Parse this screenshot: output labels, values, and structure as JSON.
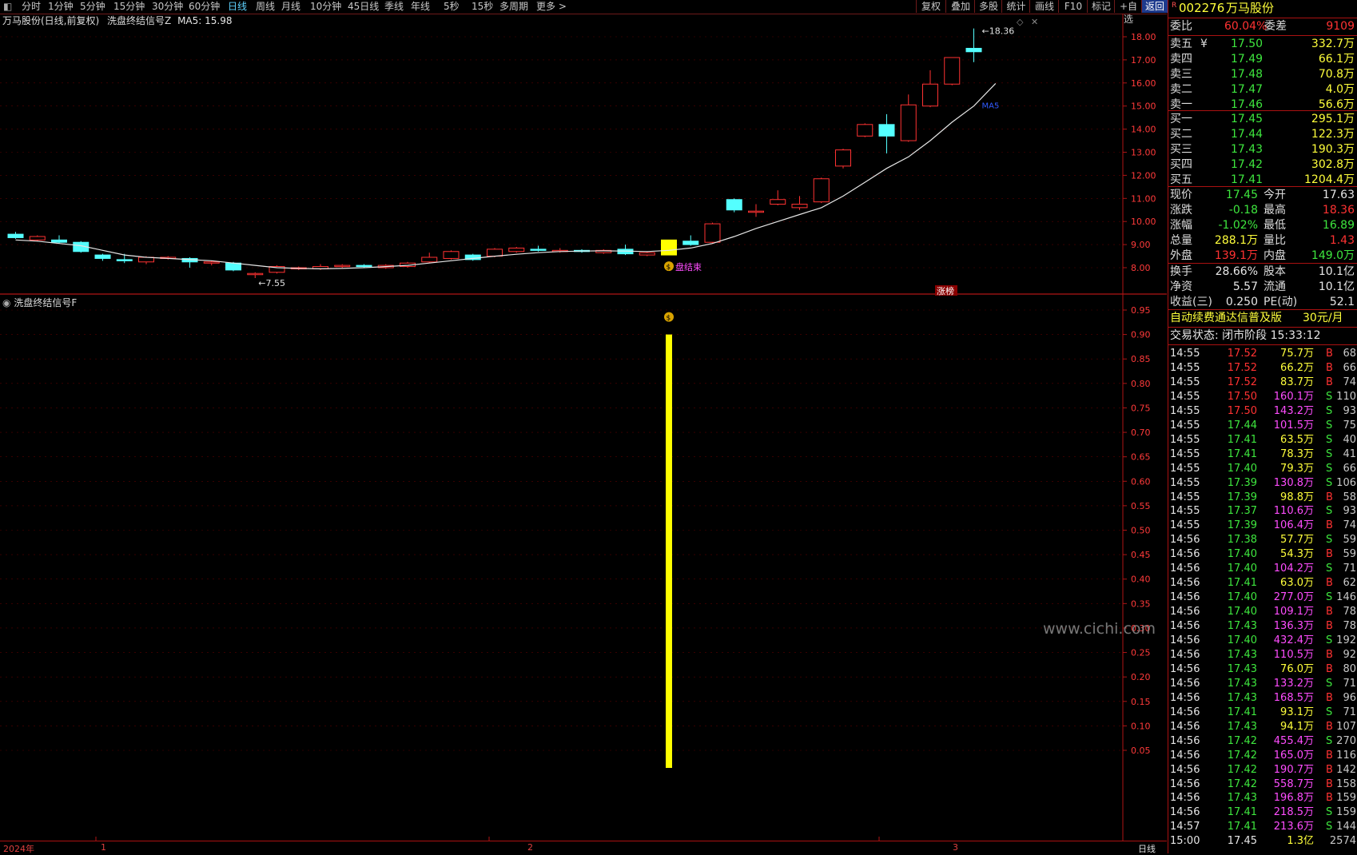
{
  "toolbar": {
    "timeframes": [
      "分时",
      "1分钟",
      "5分钟",
      "15分钟",
      "30分钟",
      "60分钟",
      "日线",
      "周线",
      "月线",
      "10分钟",
      "45日线",
      "季线",
      "年线",
      "5秒",
      "15秒",
      "多周期",
      "更多 >"
    ],
    "active": "日线",
    "buttons": [
      "复权",
      "叠加",
      "多股",
      "统计",
      "画线",
      "F10",
      "标记",
      "+自选",
      "返回"
    ]
  },
  "main_chart": {
    "title": "万马股份(日线,前复权)",
    "indicator": "洗盘终结信号Z",
    "ma_label": "MA5: 15.98",
    "high_label": "18.36",
    "low_label": "7.55",
    "signal_label": "盘结束",
    "ma_tag": "MA5",
    "badge": "涨榜",
    "y_ticks": [
      "18.00",
      "17.00",
      "16.00",
      "15.00",
      "14.00",
      "13.00",
      "12.00",
      "11.00",
      "10.00",
      "9.00",
      "8.00"
    ]
  },
  "sub_chart": {
    "title": "洗盘终结信号F",
    "y_ticks": [
      "0.95",
      "0.90",
      "0.85",
      "0.80",
      "0.75",
      "0.70",
      "0.65",
      "0.60",
      "0.55",
      "0.50",
      "0.45",
      "0.40",
      "0.35",
      "0.30",
      "0.25",
      "0.20",
      "0.15",
      "0.10",
      "0.05"
    ]
  },
  "chart_data": {
    "type": "candlestick",
    "title": "万马股份(日线,前复权)",
    "ma5_last": 15.98,
    "ylim": [
      7.4,
      18.5
    ],
    "x_axis_labels": [
      "2024年",
      "1",
      "2",
      "3"
    ],
    "candles": [
      {
        "o": 9.45,
        "c": 9.3,
        "h": 9.55,
        "l": 9.25
      },
      {
        "o": 9.2,
        "c": 9.35,
        "h": 9.4,
        "l": 9.15
      },
      {
        "o": 9.2,
        "c": 9.1,
        "h": 9.4,
        "l": 9.05
      },
      {
        "o": 9.1,
        "c": 8.7,
        "h": 9.15,
        "l": 8.65
      },
      {
        "o": 8.55,
        "c": 8.4,
        "h": 8.6,
        "l": 8.3
      },
      {
        "o": 8.35,
        "c": 8.3,
        "h": 8.6,
        "l": 8.2
      },
      {
        "o": 8.25,
        "c": 8.45,
        "h": 8.5,
        "l": 8.15
      },
      {
        "o": 8.4,
        "c": 8.45,
        "h": 8.5,
        "l": 8.35
      },
      {
        "o": 8.4,
        "c": 8.25,
        "h": 8.45,
        "l": 8.0
      },
      {
        "o": 8.25,
        "c": 8.25,
        "h": 8.3,
        "l": 8.1
      },
      {
        "o": 8.2,
        "c": 7.9,
        "h": 8.25,
        "l": 7.85
      },
      {
        "o": 7.75,
        "c": 7.75,
        "h": 7.8,
        "l": 7.55
      },
      {
        "o": 7.8,
        "c": 8.05,
        "h": 8.1,
        "l": 7.75
      },
      {
        "o": 7.95,
        "c": 8.0,
        "h": 8.05,
        "l": 7.9
      },
      {
        "o": 7.95,
        "c": 8.05,
        "h": 8.15,
        "l": 7.9
      },
      {
        "o": 8.05,
        "c": 8.1,
        "h": 8.15,
        "l": 8.0
      },
      {
        "o": 8.1,
        "c": 8.05,
        "h": 8.15,
        "l": 8.0
      },
      {
        "o": 8.0,
        "c": 8.1,
        "h": 8.15,
        "l": 7.95
      },
      {
        "o": 8.05,
        "c": 8.2,
        "h": 8.25,
        "l": 8.0
      },
      {
        "o": 8.25,
        "c": 8.45,
        "h": 8.65,
        "l": 8.2
      },
      {
        "o": 8.4,
        "c": 8.7,
        "h": 8.75,
        "l": 8.35
      },
      {
        "o": 8.55,
        "c": 8.35,
        "h": 8.6,
        "l": 8.3
      },
      {
        "o": 8.5,
        "c": 8.8,
        "h": 8.85,
        "l": 8.45
      },
      {
        "o": 8.7,
        "c": 8.85,
        "h": 8.9,
        "l": 8.65
      },
      {
        "o": 8.8,
        "c": 8.75,
        "h": 8.95,
        "l": 8.7
      },
      {
        "o": 8.75,
        "c": 8.75,
        "h": 8.85,
        "l": 8.65
      },
      {
        "o": 8.75,
        "c": 8.7,
        "h": 8.8,
        "l": 8.65
      },
      {
        "o": 8.65,
        "c": 8.75,
        "h": 8.8,
        "l": 8.6
      },
      {
        "o": 8.8,
        "c": 8.6,
        "h": 9.0,
        "l": 8.55
      },
      {
        "o": 8.55,
        "c": 8.65,
        "h": 8.7,
        "l": 8.5
      },
      {
        "o": 8.55,
        "c": 9.2,
        "h": 9.2,
        "l": 8.55,
        "signal": true
      },
      {
        "o": 9.15,
        "c": 9.0,
        "h": 9.4,
        "l": 8.95
      },
      {
        "o": 9.1,
        "c": 9.9,
        "h": 9.95,
        "l": 9.05
      },
      {
        "o": 10.95,
        "c": 10.5,
        "h": 11.0,
        "l": 10.4
      },
      {
        "o": 10.45,
        "c": 10.45,
        "h": 10.75,
        "l": 10.2
      },
      {
        "o": 10.75,
        "c": 10.95,
        "h": 11.35,
        "l": 10.7
      },
      {
        "o": 10.6,
        "c": 10.75,
        "h": 11.1,
        "l": 10.5
      },
      {
        "o": 10.85,
        "c": 11.85,
        "h": 11.9,
        "l": 10.8
      },
      {
        "o": 12.4,
        "c": 13.1,
        "h": 13.15,
        "l": 12.3
      },
      {
        "o": 13.7,
        "c": 14.2,
        "h": 14.25,
        "l": 13.65
      },
      {
        "o": 14.2,
        "c": 13.7,
        "h": 14.65,
        "l": 12.95
      },
      {
        "o": 13.5,
        "c": 15.05,
        "h": 15.5,
        "l": 13.45
      },
      {
        "o": 15.0,
        "c": 15.95,
        "h": 16.55,
        "l": 14.95
      },
      {
        "o": 15.95,
        "c": 17.1,
        "h": 17.1,
        "l": 15.9
      },
      {
        "o": 17.5,
        "c": 17.35,
        "h": 18.36,
        "l": 16.9
      }
    ],
    "ma5": [
      9.2,
      9.15,
      9.05,
      8.95,
      8.75,
      8.55,
      8.45,
      8.4,
      8.35,
      8.3,
      8.2,
      8.1,
      8.0,
      7.97,
      7.95,
      7.97,
      8.0,
      8.05,
      8.1,
      8.2,
      8.3,
      8.4,
      8.5,
      8.58,
      8.65,
      8.7,
      8.72,
      8.73,
      8.72,
      8.7,
      8.75,
      8.85,
      9.05,
      9.35,
      9.7,
      10.0,
      10.3,
      10.6,
      11.1,
      11.7,
      12.3,
      12.8,
      13.5,
      14.3,
      15.0,
      15.98
    ],
    "indicator_F": {
      "ylim": [
        0,
        1
      ],
      "signal_index": 30,
      "signal_value": 0.9
    }
  },
  "panel": {
    "code": "002276",
    "name": "万马股份",
    "ratio_label": "委比",
    "ratio_value": "60.04%",
    "diff_label": "委差",
    "diff_value": "9109",
    "asks": [
      {
        "label": "卖五",
        "mark": "¥",
        "price": "17.50",
        "vol": "332.7万"
      },
      {
        "label": "卖四",
        "price": "17.49",
        "vol": "66.1万"
      },
      {
        "label": "卖三",
        "price": "17.48",
        "vol": "70.8万"
      },
      {
        "label": "卖二",
        "price": "17.47",
        "vol": "4.0万"
      },
      {
        "label": "卖一",
        "price": "17.46",
        "vol": "56.6万"
      }
    ],
    "bids": [
      {
        "label": "买一",
        "price": "17.45",
        "vol": "295.1万"
      },
      {
        "label": "买二",
        "price": "17.44",
        "vol": "122.3万"
      },
      {
        "label": "买三",
        "price": "17.43",
        "vol": "190.3万"
      },
      {
        "label": "买四",
        "price": "17.42",
        "vol": "302.8万"
      },
      {
        "label": "买五",
        "price": "17.41",
        "vol": "1204.4万"
      }
    ],
    "quote": [
      {
        "l1": "现价",
        "v1": "17.45",
        "l2": "今开",
        "v2": "17.63",
        "c1": "green",
        "c2": "white"
      },
      {
        "l1": "涨跌",
        "v1": "-0.18",
        "l2": "最高",
        "v2": "18.36",
        "c1": "green",
        "c2": "red"
      },
      {
        "l1": "涨幅",
        "v1": "-1.02%",
        "l2": "最低",
        "v2": "16.89",
        "c1": "green",
        "c2": "green"
      },
      {
        "l1": "总量",
        "v1": "288.1万",
        "l2": "量比",
        "v2": "1.43",
        "c1": "yellow",
        "c2": "red"
      },
      {
        "l1": "外盘",
        "v1": "139.1万",
        "l2": "内盘",
        "v2": "149.0万",
        "c1": "red",
        "c2": "green"
      }
    ],
    "fund": [
      {
        "l1": "换手",
        "v1": "28.66%",
        "l2": "股本",
        "v2": "10.1亿"
      },
      {
        "l1": "净资",
        "v1": "5.57",
        "l2": "流通",
        "v2": "10.1亿"
      },
      {
        "l1": "收益(三)",
        "v1": "0.250",
        "l2": "PE(动)",
        "v2": "52.1"
      }
    ],
    "promo": "自动续费通达信普及版",
    "promo_price": "30元/月",
    "status": "交易状态: 闭市阶段 15:33:12",
    "ticks": [
      [
        "14:55",
        "17.52",
        "75.7万",
        "B",
        "68"
      ],
      [
        "14:55",
        "17.52",
        "66.2万",
        "B",
        "66"
      ],
      [
        "14:55",
        "17.52",
        "83.7万",
        "B",
        "74"
      ],
      [
        "14:55",
        "17.50",
        "160.1万",
        "S",
        "110"
      ],
      [
        "14:55",
        "17.50",
        "143.2万",
        "S",
        "93"
      ],
      [
        "14:55",
        "17.44",
        "101.5万",
        "S",
        "75"
      ],
      [
        "14:55",
        "17.41",
        "63.5万",
        "S",
        "40"
      ],
      [
        "14:55",
        "17.41",
        "78.3万",
        "S",
        "41"
      ],
      [
        "14:55",
        "17.40",
        "79.3万",
        "S",
        "66"
      ],
      [
        "14:55",
        "17.39",
        "130.8万",
        "S",
        "106"
      ],
      [
        "14:55",
        "17.39",
        "98.8万",
        "B",
        "58"
      ],
      [
        "14:55",
        "17.37",
        "110.6万",
        "S",
        "93"
      ],
      [
        "14:55",
        "17.39",
        "106.4万",
        "B",
        "74"
      ],
      [
        "14:56",
        "17.38",
        "57.7万",
        "S",
        "59"
      ],
      [
        "14:56",
        "17.40",
        "54.3万",
        "B",
        "59"
      ],
      [
        "14:56",
        "17.40",
        "104.2万",
        "S",
        "71"
      ],
      [
        "14:56",
        "17.41",
        "63.0万",
        "B",
        "62"
      ],
      [
        "14:56",
        "17.40",
        "277.0万",
        "S",
        "146"
      ],
      [
        "14:56",
        "17.40",
        "109.1万",
        "B",
        "78"
      ],
      [
        "14:56",
        "17.43",
        "136.3万",
        "B",
        "78"
      ],
      [
        "14:56",
        "17.40",
        "432.4万",
        "S",
        "192"
      ],
      [
        "14:56",
        "17.43",
        "110.5万",
        "B",
        "92"
      ],
      [
        "14:56",
        "17.43",
        "76.0万",
        "B",
        "80"
      ],
      [
        "14:56",
        "17.43",
        "133.2万",
        "S",
        "71"
      ],
      [
        "14:56",
        "17.43",
        "168.5万",
        "B",
        "96"
      ],
      [
        "14:56",
        "17.41",
        "93.1万",
        "S",
        "71"
      ],
      [
        "14:56",
        "17.43",
        "94.1万",
        "B",
        "107"
      ],
      [
        "14:56",
        "17.42",
        "455.4万",
        "S",
        "270"
      ],
      [
        "14:56",
        "17.42",
        "165.0万",
        "B",
        "116"
      ],
      [
        "14:56",
        "17.42",
        "190.7万",
        "B",
        "142"
      ],
      [
        "14:56",
        "17.42",
        "558.7万",
        "B",
        "158"
      ],
      [
        "14:56",
        "17.43",
        "196.8万",
        "B",
        "159"
      ],
      [
        "14:56",
        "17.41",
        "218.5万",
        "S",
        "159"
      ],
      [
        "14:57",
        "17.41",
        "213.6万",
        "S",
        "144"
      ],
      [
        "15:00",
        "17.45",
        "1.3亿",
        "",
        "2574"
      ]
    ]
  },
  "bottom": {
    "period_label": "日线"
  },
  "watermark": "www.cichi.com"
}
